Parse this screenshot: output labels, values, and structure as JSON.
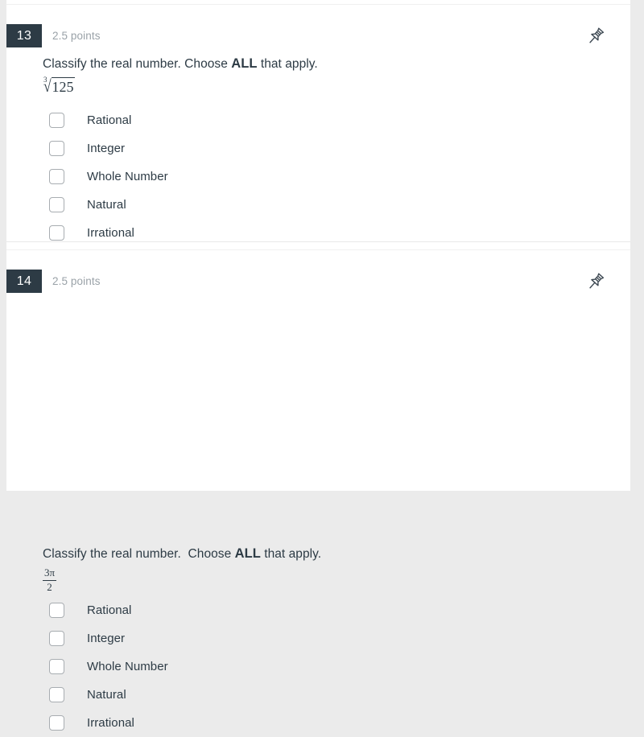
{
  "theme": {
    "page_background": "#ebebeb",
    "card_background": "#ffffff",
    "badge_background": "#2d3b45",
    "badge_text": "#ffffff",
    "points_text": "#9aa2a8",
    "body_text": "#2d3b45",
    "checkbox_border": "#a8adb1"
  },
  "questions": [
    {
      "number": "13",
      "points": "2.5 points",
      "pin_icon": "pushpin-icon",
      "prompt_before": "Classify the real number. Choose ",
      "prompt_emphasis": "ALL",
      "prompt_after": " that apply.",
      "expression": {
        "type": "radical",
        "index": "3",
        "radical_sign": "√",
        "radicand": "125",
        "plain": "∛125"
      },
      "options": [
        {
          "label": "Rational",
          "checked": false
        },
        {
          "label": "Integer",
          "checked": false
        },
        {
          "label": "Whole Number",
          "checked": false
        },
        {
          "label": "Natural",
          "checked": false
        },
        {
          "label": "Irrational",
          "checked": false
        }
      ]
    },
    {
      "number": "14",
      "points": "2.5 points",
      "pin_icon": "pushpin-icon",
      "prompt_before": "Classify the real number.  Choose ",
      "prompt_emphasis": "ALL",
      "prompt_after": " that apply.",
      "expression": {
        "type": "fraction",
        "numerator": "3π",
        "denominator": "2",
        "plain": "3π/2"
      },
      "options": [
        {
          "label": "Rational",
          "checked": false
        },
        {
          "label": "Integer",
          "checked": false
        },
        {
          "label": "Whole Number",
          "checked": false
        },
        {
          "label": "Natural",
          "checked": false
        },
        {
          "label": "Irrational",
          "checked": false
        }
      ]
    }
  ]
}
